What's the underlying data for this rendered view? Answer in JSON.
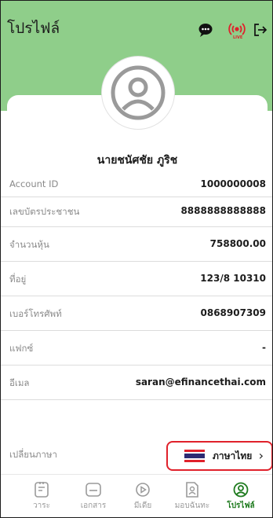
{
  "header": {
    "title": "โปรไฟล์",
    "icons": [
      "chat-bubble-icon",
      "live-broadcast-icon",
      "logout-icon"
    ],
    "live_badge": "LIVE",
    "bg_color": "#8fce8a"
  },
  "profile": {
    "name": "นายชนัศชัย ภูริช"
  },
  "fields": [
    {
      "label": "Account ID",
      "value": "1000000008"
    },
    {
      "label": "เลขบัตรประชาชน",
      "value": "8888888888888"
    },
    {
      "label": "จำนวนหุ้น",
      "value": "758800.00"
    },
    {
      "label": "ที่อยู่",
      "value": "123/8 10310"
    },
    {
      "label": "เบอร์โทรศัพท์",
      "value": "0868907309"
    },
    {
      "label": "แฟกซ์",
      "value": "-"
    },
    {
      "label": "อีเมล",
      "value": "saran@efinancethai.com"
    }
  ],
  "language": {
    "label": "เปลี่ยนภาษา",
    "current": "ภาษาไทย",
    "highlight_color": "#e0212b"
  },
  "nav": {
    "items": [
      {
        "label": "วาระ",
        "icon": "agenda-icon"
      },
      {
        "label": "เอกสาร",
        "icon": "document-icon"
      },
      {
        "label": "มีเดีย",
        "icon": "media-play-icon"
      },
      {
        "label": "มอบฉันทะ",
        "icon": "proxy-icon"
      },
      {
        "label": "โปรไฟล์",
        "icon": "profile-icon"
      }
    ],
    "active_color": "#1d7a1d"
  }
}
